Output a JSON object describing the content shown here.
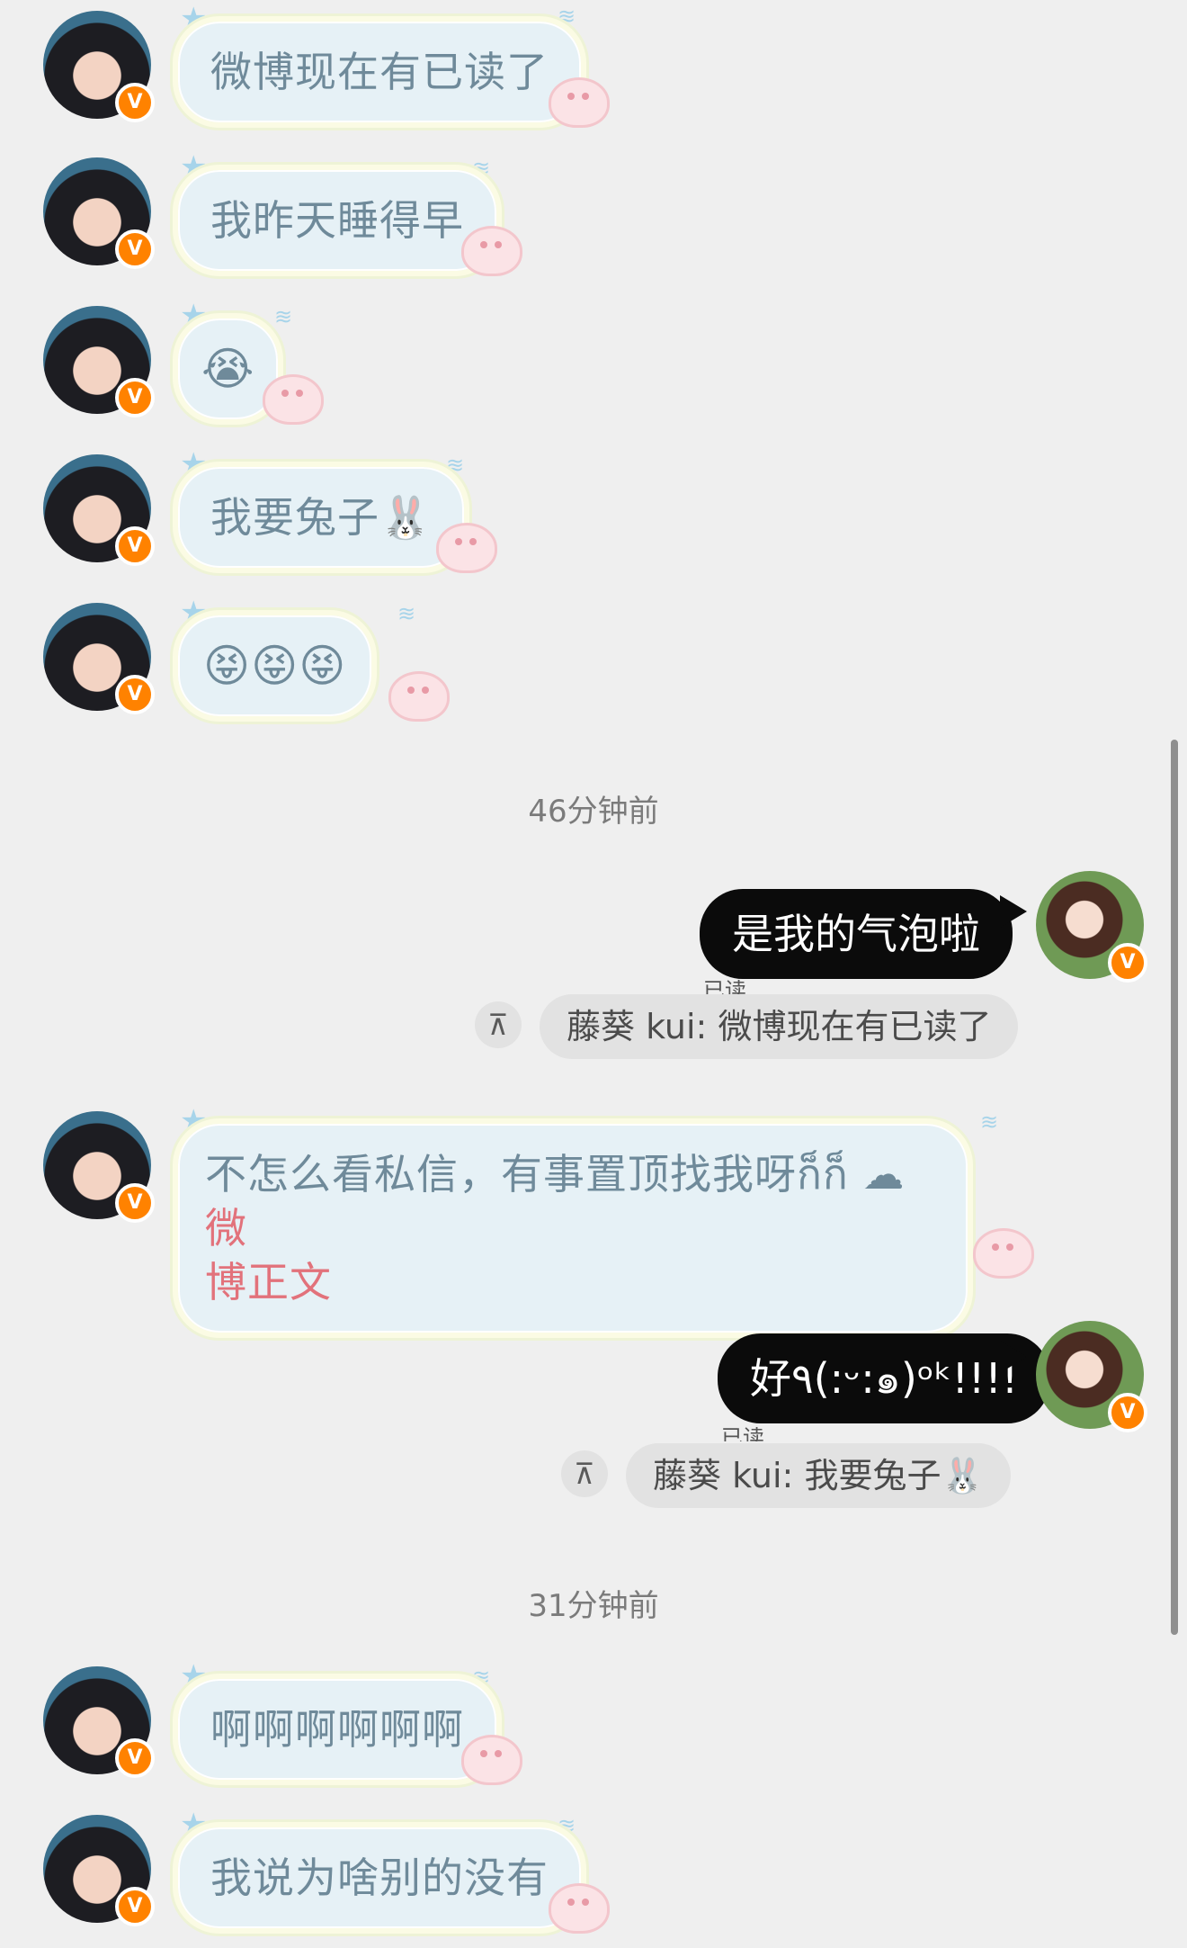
{
  "messages": {
    "m1": "微博现在有已读了",
    "m2": "我昨天睡得早",
    "m3": "😭",
    "m4": "我要兔子🐰",
    "m5": "😝😝😝",
    "m6_a": "不怎么看私信，有事置顶找我呀ก็ก็ ☁",
    "m6_b": "微",
    "m6_c": "博正文",
    "m8": "啊啊啊啊啊啊",
    "m9": "我说为啥别的没有"
  },
  "outgoing": {
    "o1": "是我的气泡啦",
    "o2": "好٩(:ᵕ:๑)ᵒᵏ!!!!"
  },
  "read_label": "已读",
  "quotes": {
    "q1": "藤葵 kui: 微博现在有已读了",
    "q2": "藤葵 kui: 我要兔子🐰"
  },
  "pin_icon_glyph": "⊼",
  "timestamps": {
    "t1": "46分钟前",
    "t2": "31分钟前"
  },
  "badge_letter": "V",
  "colors": {
    "background": "#efefef",
    "bubble_in": "#e6f1f6",
    "bubble_out": "#0b0b0b",
    "badge": "#ff8200",
    "link_pink": "#e2727b"
  }
}
